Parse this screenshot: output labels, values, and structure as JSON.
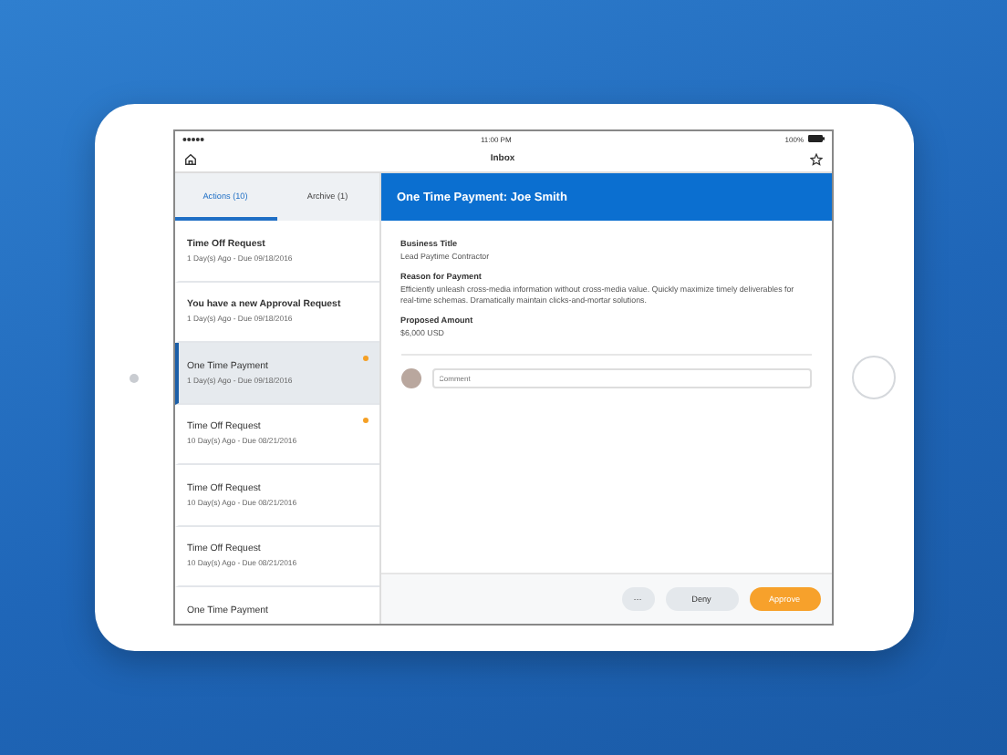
{
  "status_bar": {
    "time": "11:00 PM",
    "battery": "100%"
  },
  "nav": {
    "title": "Inbox"
  },
  "tabs": [
    {
      "label": "Actions (10)",
      "selected": true
    },
    {
      "label": "Archive (1)",
      "selected": false
    }
  ],
  "items": [
    {
      "title": "Time Off Request",
      "subtitle": "1 Day(s) Ago - Due 09/18/2016",
      "selected": false,
      "flagged": false
    },
    {
      "title": "You have a new Approval Request",
      "subtitle": "1 Day(s) Ago - Due 09/18/2016",
      "selected": false,
      "flagged": false
    },
    {
      "title": "One Time Payment",
      "subtitle": "1 Day(s) Ago - Due 09/18/2016",
      "selected": true,
      "flagged": true
    },
    {
      "title": "Time Off Request",
      "subtitle": "10 Day(s) Ago - Due 08/21/2016",
      "selected": false,
      "flagged": true
    },
    {
      "title": "Time Off Request",
      "subtitle": "10 Day(s) Ago - Due 08/21/2016",
      "selected": false,
      "flagged": false
    },
    {
      "title": "Time Off Request",
      "subtitle": "10 Day(s) Ago - Due 08/21/2016",
      "selected": false,
      "flagged": false
    },
    {
      "title": "One Time Payment",
      "selected": false,
      "flagged": false
    }
  ],
  "detail": {
    "title": "One Time Payment: Joe Smith",
    "fields": [
      {
        "label": "Business Title",
        "value": "Lead Paytime Contractor"
      },
      {
        "label": "Reason for Payment",
        "value": "Efficiently unleash cross-media information without cross-media value. Quickly maximize timely deliverables for real-time schemas. Dramatically maintain clicks-and-mortar solutions."
      },
      {
        "label": "Proposed Amount",
        "value": "$6,000 USD"
      }
    ],
    "comment": {
      "placeholder": "Comment"
    },
    "buttons": [
      {
        "label": "···",
        "kind": "more"
      },
      {
        "label": "Deny",
        "kind": "secondary"
      },
      {
        "label": "Approve",
        "kind": "primary"
      }
    ]
  }
}
